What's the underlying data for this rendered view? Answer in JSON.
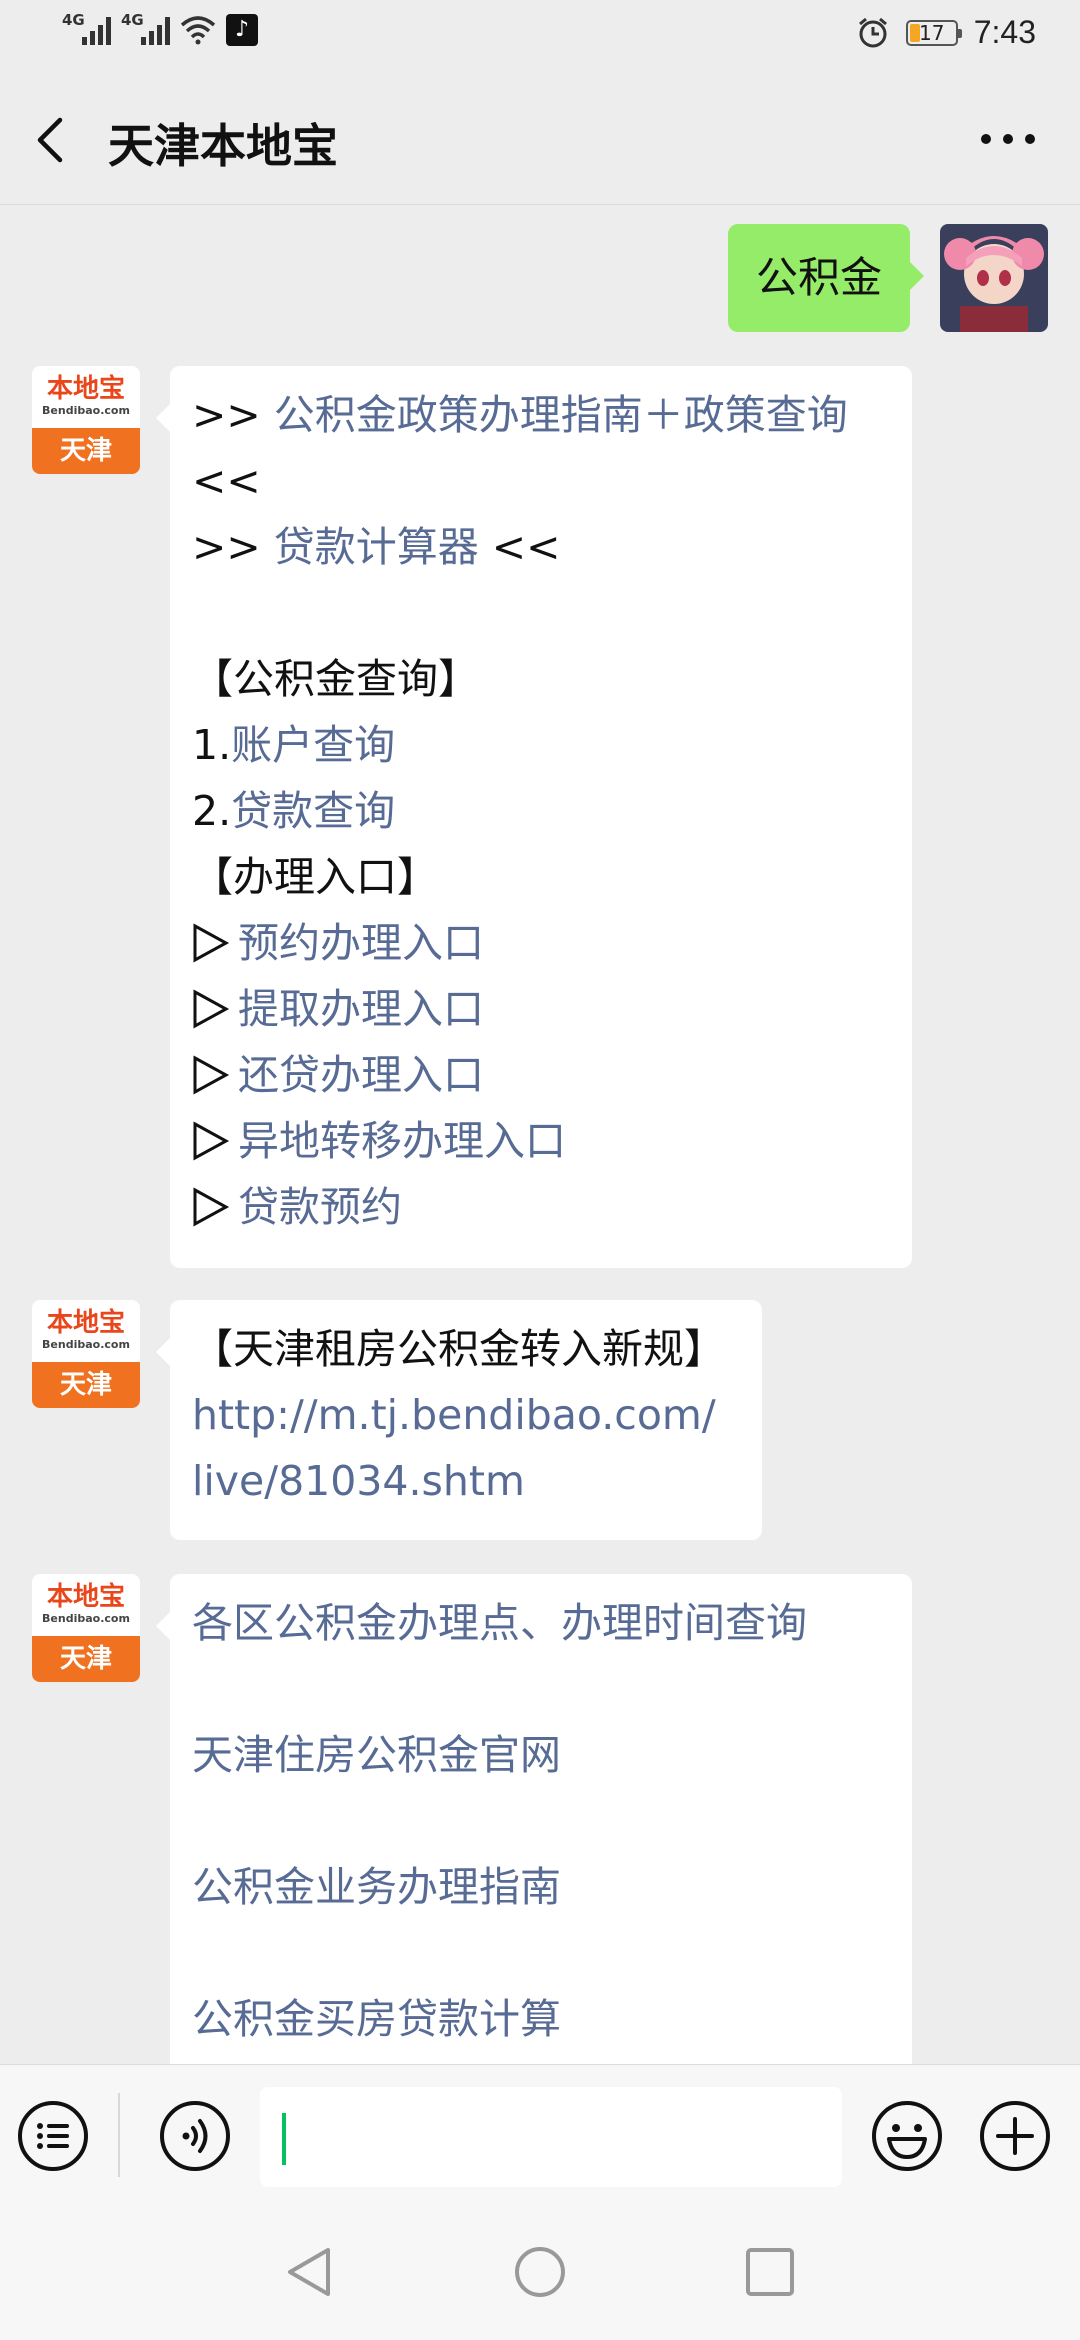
{
  "status_bar": {
    "signal1_label": "4G",
    "signal2_label": "4G",
    "battery_level": "17",
    "time": "7:43"
  },
  "header": {
    "title": "天津本地宝"
  },
  "bot_avatar": {
    "brand": "本地宝",
    "domain": "Bendibao.com",
    "city": "天津"
  },
  "messages": {
    "user_text": "公积金",
    "msg1": {
      "prefix1": ">> ",
      "link1": "公积金政策办理指南＋政策查询",
      "suffix1": "<<",
      "prefix2": ">> ",
      "link2": "贷款计算器",
      "suffix2": " <<",
      "heading1": "【公积金查询】",
      "num1": "1.",
      "item1": "账户查询",
      "num2": "2.",
      "item2": "贷款查询",
      "heading2": "【办理入口】",
      "entries": [
        "预约办理入口",
        "提取办理入口",
        "还贷办理入口",
        "异地转移办理入口",
        "贷款预约"
      ]
    },
    "msg2": {
      "heading": "【天津租房公积金转入新规】",
      "url_line1": "http://m.tj.bendibao.com/",
      "url_line2": "live/81034.shtm"
    },
    "msg3": {
      "links": [
        "各区公积金办理点、办理时间查询",
        "天津住房公积金官网",
        "公积金业务办理指南",
        "公积金买房贷款计算"
      ]
    }
  },
  "input": {
    "value": ""
  },
  "colors": {
    "background": "#ededed",
    "user_bubble": "#95ec69",
    "link": "#576b95",
    "brand_orange": "#f07221"
  }
}
